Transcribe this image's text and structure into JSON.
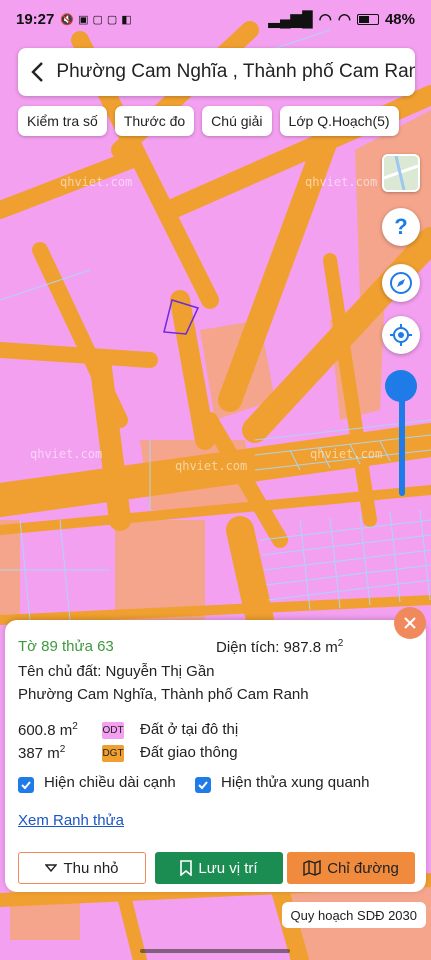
{
  "status": {
    "time": "19:27",
    "battery": "48%",
    "battery_level": 0.48
  },
  "titlebar": {
    "back_icon": "chevron-left-icon",
    "title": "Phường Cam Nghĩa , Thành phố Cam Ranh"
  },
  "chips": [
    {
      "label": "Kiểm tra số"
    },
    {
      "label": "Thước đo"
    },
    {
      "label": "Chú giải"
    },
    {
      "label": "Lớp Q.Hoạch(5)"
    }
  ],
  "map": {
    "watermark": "qhviet.com",
    "colors": {
      "residential": "#f3a0f0",
      "road": "#f0a030",
      "parcel_line": "#a8d8ff",
      "salmon_zone": "#f5a58c",
      "selected_parcel": "#6a2bd8"
    }
  },
  "controls": {
    "help_icon": "help-icon",
    "compass_icon": "compass-icon",
    "locate_icon": "locate-icon",
    "layer_icon": "map-layer-icon"
  },
  "card": {
    "parcel_id": "Tờ 89 thửa 63",
    "area_label": "Diện tích: 987.8 m",
    "area_sup": "2",
    "owner": "Tên chủ đất: Nguyễn Thị Gần",
    "address": "Phường Cam Nghĩa, Thành phố Cam Ranh",
    "landuse": [
      {
        "area": "600.8 m",
        "sup": "2",
        "code": "ODT",
        "desc": "Đất ở tại đô thị",
        "color": "#f3a0f0"
      },
      {
        "area": "387 m",
        "sup": "2",
        "code": "DGT",
        "desc": "Đất giao thông",
        "color": "#f0a030"
      }
    ],
    "check_edge_length": "Hiện chiều dài cạnh",
    "check_neighbors": "Hiện thửa xung quanh",
    "view_boundary": "Xem Ranh thửa",
    "btn_shrink": "Thu nhỏ",
    "btn_save": "Lưu vị trí",
    "btn_directions": "Chỉ đường"
  },
  "plan_label": "Quy hoạch SDĐ 2030"
}
